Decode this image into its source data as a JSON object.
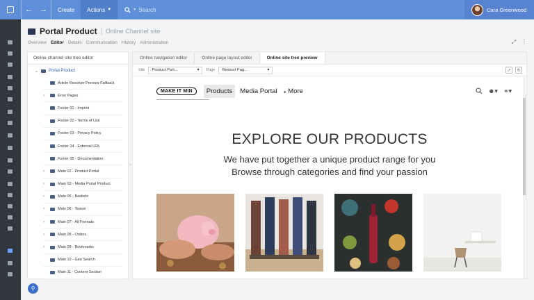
{
  "topbar": {
    "create": "Create",
    "actions": "Actions",
    "search_placeholder": "Search",
    "user_name": "Cara Greenwood"
  },
  "header": {
    "title": "Portal Product",
    "subtitle": "Online Channel site",
    "tabs": [
      "Overview",
      "Editor",
      "Details",
      "Communication",
      "History",
      "Administration"
    ],
    "active_tab": "Editor"
  },
  "tree": {
    "heading": "Online channel site tree editor",
    "root": "Portal Product",
    "items": [
      {
        "label": "Article Resolver Preview Fallback",
        "expandable": false
      },
      {
        "label": "Error Pages",
        "expandable": true
      },
      {
        "label": "Footer 01 - Imprint",
        "expandable": false
      },
      {
        "label": "Footer 02 - Terms of Use",
        "expandable": false
      },
      {
        "label": "Footer 03 - Privacy Policy",
        "expandable": false
      },
      {
        "label": "Footer 04 - External URL",
        "expandable": false
      },
      {
        "label": "Footer 05 - Documentation",
        "expandable": false
      },
      {
        "label": "Main 02 - Product Portal",
        "expandable": true
      },
      {
        "label": "Main 03 - Media Portal Product",
        "expandable": true
      },
      {
        "label": "Main 05 - Baskets",
        "expandable": true
      },
      {
        "label": "Main 06 - Teaser",
        "expandable": true
      },
      {
        "label": "Main 07 - All Formats",
        "expandable": true
      },
      {
        "label": "Main 08 - Orders",
        "expandable": true
      },
      {
        "label": "Main 09 - Bookmarks",
        "expandable": true
      },
      {
        "label": "Main 10 - Geo Search",
        "expandable": false
      },
      {
        "label": "Main 11 - Content Section",
        "expandable": false
      }
    ]
  },
  "panel": {
    "tabs": [
      "Online navigation editor",
      "Online page layout editor",
      "Online site tree preview"
    ],
    "active_tab": "Online site tree preview",
    "site_label": "Site",
    "site_value": "Product Port...",
    "page_label": "Page",
    "page_value": "Ressort Pag..."
  },
  "preview": {
    "logo": "MAKE IT MIN",
    "nav": [
      "Products",
      "Media Portal"
    ],
    "nav_active": "Products",
    "more": "More",
    "hero_title": "EXPLORE OUR PRODUCTS",
    "hero_line1": "We have put together a unique product range for you",
    "hero_line2": "Browse through categories and find your passion"
  },
  "colors": {
    "topbar": "#5f8fd9",
    "rail": "#32373d",
    "accent": "#2a5db0"
  }
}
